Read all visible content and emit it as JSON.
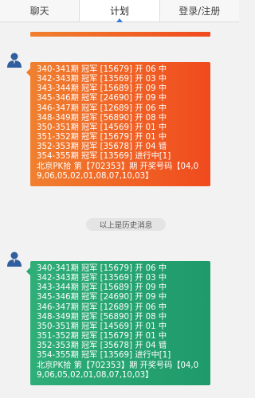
{
  "tabs": [
    {
      "label": "聊天"
    },
    {
      "label": "计划"
    },
    {
      "label": "登录/注册"
    }
  ],
  "history_label": "以上是历史消息",
  "messages": [
    {
      "color": "orange",
      "lines": [
        "340-341期 冠军 [15679] 开 06 中",
        "342-343期 冠军 [13569] 开 03 中",
        "343-344期 冠军 [15689] 开 09 中",
        "345-346期 冠军 [24690] 开 09 中",
        "346-347期 冠军 [12689] 开 06 中",
        "348-349期 冠军 [56890] 开 08 中",
        "350-351期 冠军 [14569] 开 01 中",
        "351-352期 冠军 [15679] 开 01 中",
        "352-353期 冠军 [35678] 开 04 错",
        "354-355期 冠军 [13569] 进行中[1]"
      ],
      "result": "北京PK拾 第【702353】期 开奖号码【04,09,06,05,02,01,08,07,10,03】"
    },
    {
      "color": "green",
      "lines": [
        "340-341期 冠军 [15679] 开 06 中",
        "342-343期 冠军 [13569] 开 03 中",
        "343-344期 冠军 [15689] 开 09 中",
        "345-346期 冠军 [24690] 开 09 中",
        "346-347期 冠军 [12689] 开 06 中",
        "348-349期 冠军 [56890] 开 08 中",
        "350-351期 冠军 [14569] 开 01 中",
        "351-352期 冠军 [15679] 开 01 中",
        "352-353期 冠军 [35678] 开 04 错",
        "354-355期 冠军 [13569] 进行中[1]"
      ],
      "result": "北京PK拾 第【702353】期 开奖号码【04,09,06,05,02,01,08,07,10,03】"
    }
  ],
  "colors": {
    "orange": "#f04a1e",
    "green": "#1f9a6b",
    "tab_caret": "#3a7bd5"
  },
  "icons": {
    "avatar": "user-avatar-icon"
  }
}
